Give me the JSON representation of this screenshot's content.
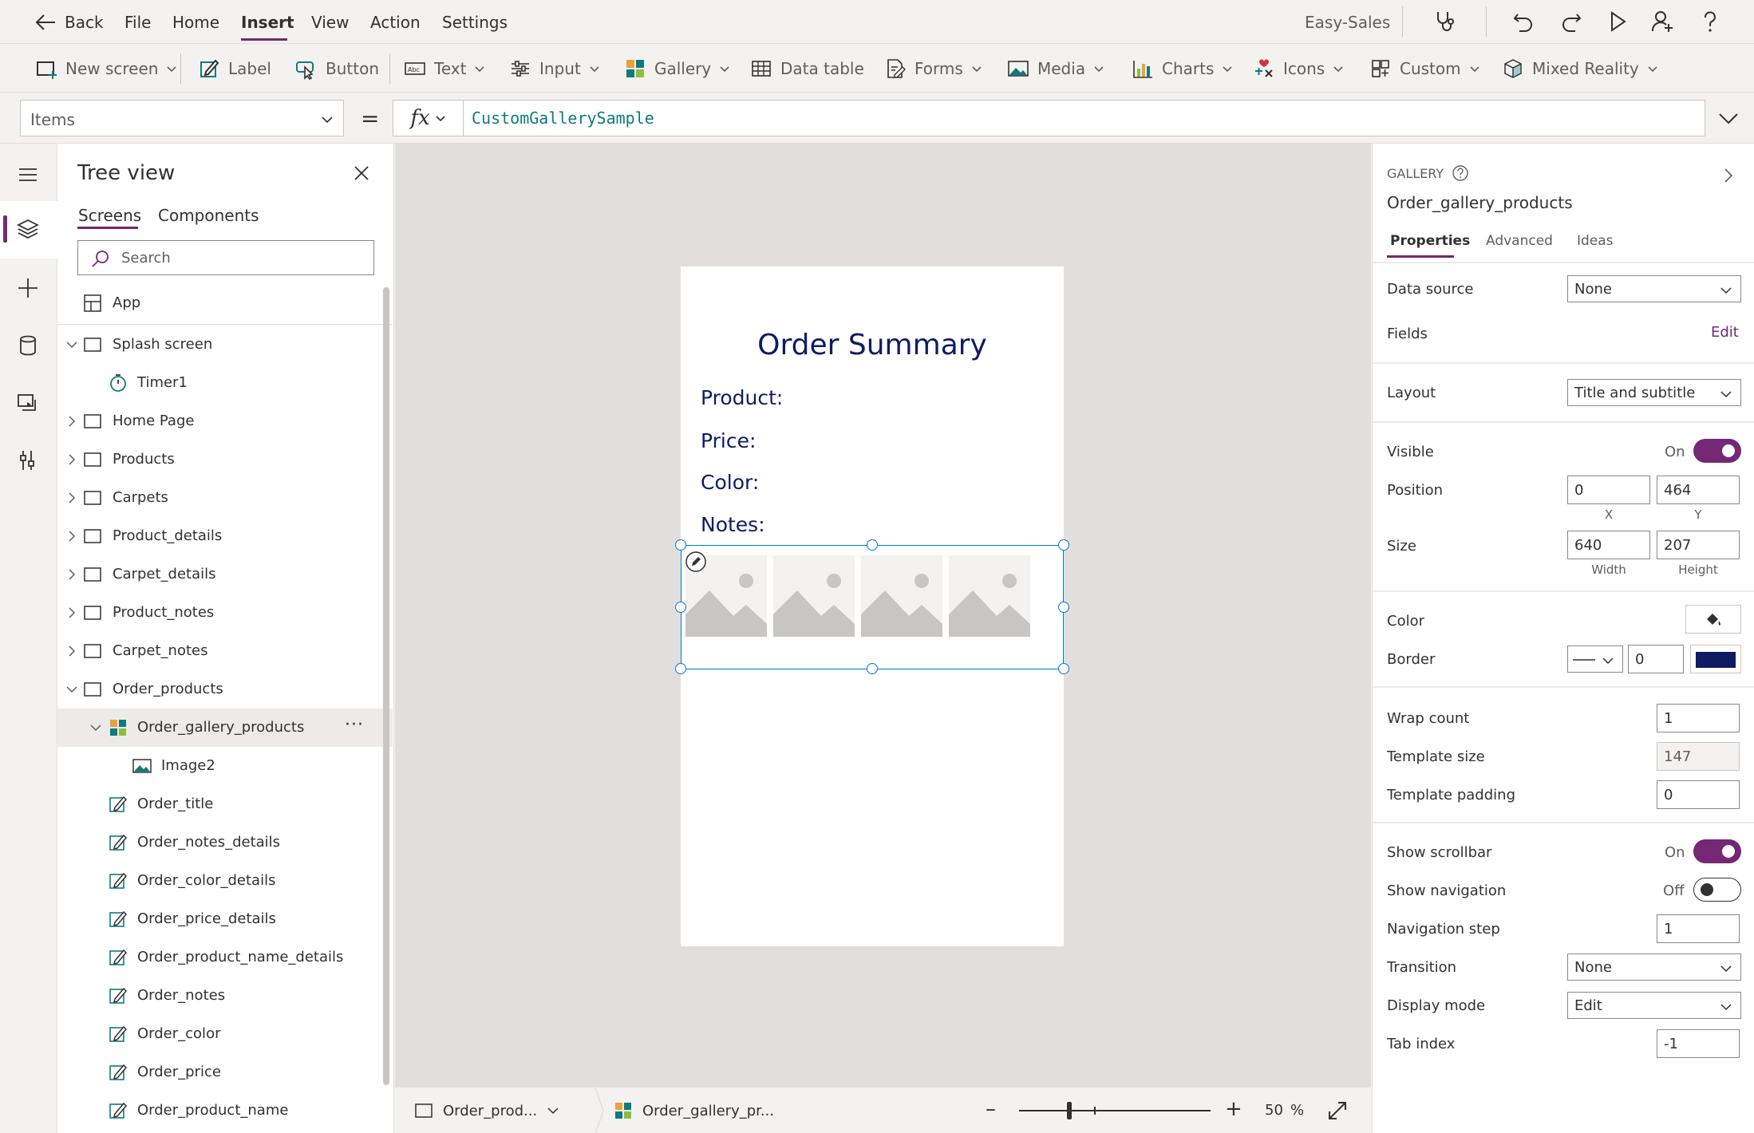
{
  "menubar": {
    "back_label": "Back",
    "items": [
      "File",
      "Home",
      "Insert",
      "View",
      "Action",
      "Settings"
    ],
    "active_item": "Insert",
    "app_name": "Easy-Sales"
  },
  "ribbon": {
    "new_screen": "New screen",
    "label": "Label",
    "button": "Button",
    "text": "Text",
    "input": "Input",
    "gallery": "Gallery",
    "data_table": "Data table",
    "forms": "Forms",
    "media": "Media",
    "charts": "Charts",
    "icons": "Icons",
    "custom": "Custom",
    "mixed_reality": "Mixed Reality"
  },
  "formula": {
    "property": "Items",
    "equals": "=",
    "fx": "fx",
    "value": "CustomGallerySample"
  },
  "tree": {
    "title": "Tree view",
    "tabs": [
      "Screens",
      "Components"
    ],
    "search_placeholder": "Search",
    "rows": [
      {
        "label": "App"
      },
      {
        "label": "Splash screen"
      },
      {
        "label": "Timer1"
      },
      {
        "label": "Home Page"
      },
      {
        "label": "Products"
      },
      {
        "label": "Carpets"
      },
      {
        "label": "Product_details"
      },
      {
        "label": "Carpet_details"
      },
      {
        "label": "Product_notes"
      },
      {
        "label": "Carpet_notes"
      },
      {
        "label": "Order_products"
      },
      {
        "label": "Order_gallery_products"
      },
      {
        "label": "Image2"
      },
      {
        "label": "Order_title"
      },
      {
        "label": "Order_notes_details"
      },
      {
        "label": "Order_color_details"
      },
      {
        "label": "Order_price_details"
      },
      {
        "label": "Order_product_name_details"
      },
      {
        "label": "Order_notes"
      },
      {
        "label": "Order_color"
      },
      {
        "label": "Order_price"
      },
      {
        "label": "Order_product_name"
      }
    ],
    "more_label": "···"
  },
  "canvas": {
    "title": "Order Summary",
    "fields": [
      "Product:",
      "Price:",
      "Color:",
      "Notes:"
    ],
    "gallery_item_count": 4
  },
  "statusbar": {
    "screen_crumb": "Order_prod...",
    "control_crumb": "Order_gallery_pr...",
    "zoom_minus": "–",
    "zoom_plus": "+",
    "zoom_value": "50",
    "zoom_unit": "%"
  },
  "props": {
    "type_label": "GALLERY",
    "control_name": "Order_gallery_products",
    "tabs": [
      "Properties",
      "Advanced",
      "Ideas"
    ],
    "data_source_label": "Data source",
    "data_source_value": "None",
    "fields_label": "Fields",
    "fields_edit": "Edit",
    "layout_label": "Layout",
    "layout_value": "Title and subtitle",
    "visible_label": "Visible",
    "visible_state": "On",
    "position_label": "Position",
    "position_x": "0",
    "position_y": "464",
    "x_caption": "X",
    "y_caption": "Y",
    "size_label": "Size",
    "size_width": "640",
    "size_height": "207",
    "width_caption": "Width",
    "height_caption": "Height",
    "color_label": "Color",
    "border_label": "Border",
    "border_width": "0",
    "border_color": "#0f1c63",
    "wrap_count_label": "Wrap count",
    "wrap_count": "1",
    "template_size_label": "Template size",
    "template_size": "147",
    "template_padding_label": "Template padding",
    "template_padding": "0",
    "show_scrollbar_label": "Show scrollbar",
    "show_scrollbar_state": "On",
    "show_navigation_label": "Show navigation",
    "show_navigation_state": "Off",
    "navigation_step_label": "Navigation step",
    "navigation_step": "1",
    "transition_label": "Transition",
    "transition_value": "None",
    "display_mode_label": "Display mode",
    "display_mode_value": "Edit",
    "tab_index_label": "Tab index",
    "tab_index": "-1"
  },
  "colors": {
    "accent": "#742774",
    "canvas_text": "#0f1c63",
    "selection": "#0078d4"
  }
}
